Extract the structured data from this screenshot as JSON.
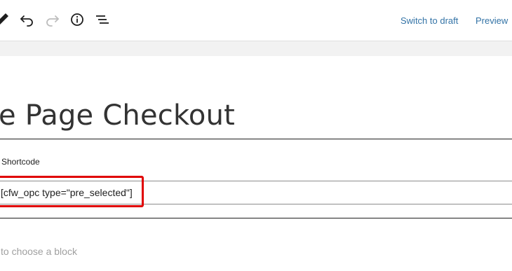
{
  "toolbar": {
    "icons": [
      "pencil-icon",
      "undo-icon",
      "redo-icon",
      "info-icon",
      "list-view-icon"
    ],
    "switch_to_draft_label": "Switch to draft",
    "preview_label": "Preview"
  },
  "editor": {
    "title": "e Page Checkout",
    "shortcode_block": {
      "label": "Shortcode",
      "value": "[cfw_opc type=\"pre_selected\"]"
    },
    "placeholder": "to choose a block"
  },
  "colors": {
    "link": "#3373a6",
    "highlight": "#e00000"
  }
}
